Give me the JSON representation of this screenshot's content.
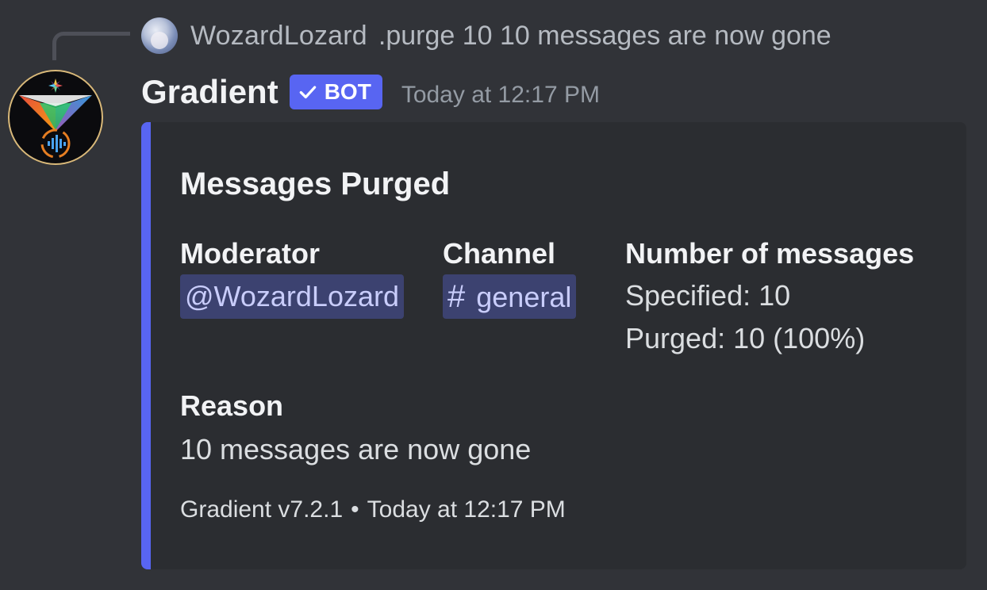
{
  "colors": {
    "background": "#313338",
    "embed_background": "#2b2d31",
    "embed_accent": "#5865f2",
    "bot_tag": "#5865f2",
    "mention_bg": "#3c4270",
    "mention_text": "#c9cdfb",
    "muted_text": "#949ba4"
  },
  "reply": {
    "author": "WozardLozard",
    "content": ".purge 10 10 messages are now gone",
    "avatar_icon": "user-avatar"
  },
  "message": {
    "author": "Gradient",
    "bot_tag": "BOT",
    "timestamp": "Today at 12:17 PM",
    "avatar_icon": "gradient-bot-logo"
  },
  "embed": {
    "title": "Messages Purged",
    "fields": {
      "moderator": {
        "name": "Moderator",
        "value": "@WozardLozard"
      },
      "channel": {
        "name": "Channel",
        "hash": "#",
        "value": "general"
      },
      "count": {
        "name": "Number of messages",
        "specified": "Specified: 10",
        "purged": "Purged: 10 (100%)"
      },
      "reason": {
        "name": "Reason",
        "value": "10 messages are now gone"
      }
    },
    "footer": {
      "text": "Gradient v7.2.1",
      "separator": "•",
      "timestamp": "Today at 12:17 PM"
    }
  }
}
